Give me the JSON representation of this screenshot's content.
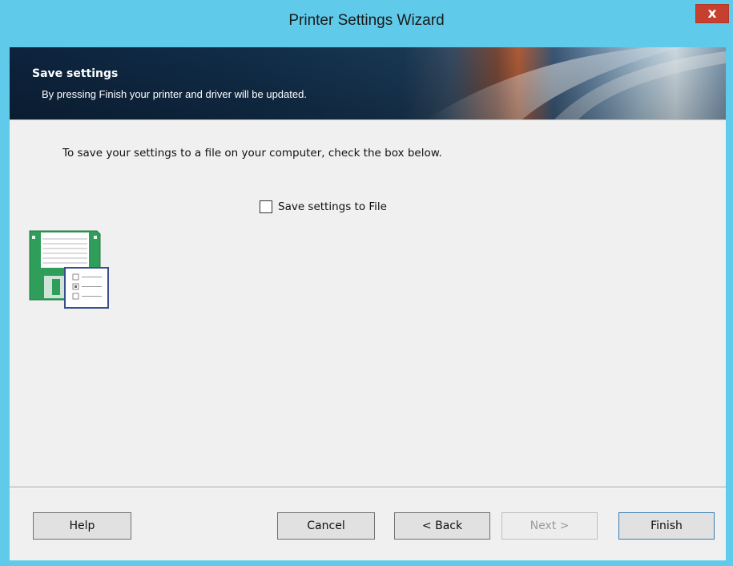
{
  "window": {
    "title": "Printer Settings Wizard",
    "close_label": "x"
  },
  "banner": {
    "title": "Save settings",
    "subtitle": "By pressing Finish your printer and driver will be updated."
  },
  "content": {
    "instruction": "To save your settings to a file on your computer, check the box below.",
    "save_to_file": {
      "label": "Save settings to File",
      "checked": false
    },
    "illustration": "floppy-disk-settings-icon"
  },
  "buttons": {
    "help": "Help",
    "cancel": "Cancel",
    "back": "< Back",
    "next": "Next >",
    "finish": "Finish"
  },
  "colors": {
    "title_bar": "#5fcae9",
    "close_button": "#c7402f",
    "banner_dark": "#0e2540",
    "dialog_bg": "#f0f0f0"
  }
}
